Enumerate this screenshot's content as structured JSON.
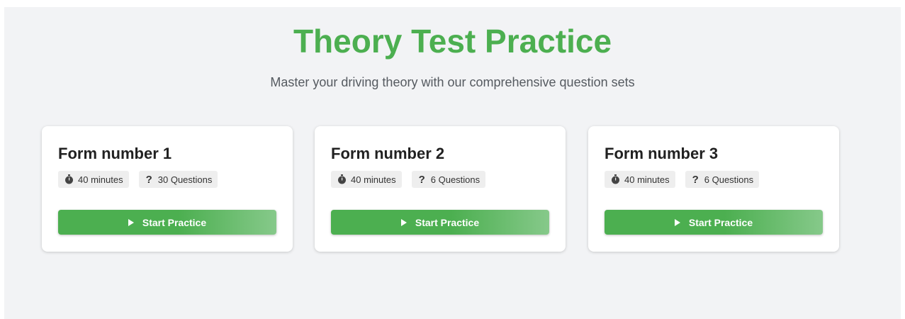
{
  "header": {
    "title": "Theory Test Practice",
    "subtitle": "Master your driving theory with our comprehensive question sets"
  },
  "colors": {
    "accent": "#4caf50",
    "background": "#f2f3f5",
    "card": "#ffffff"
  },
  "forms": [
    {
      "title": "Form number 1",
      "duration": "40 minutes",
      "questions": "30 Questions",
      "duration_icon": "stopwatch-icon",
      "questions_icon": "question-mark-icon",
      "button_label": "Start Practice",
      "button_icon": "play-icon"
    },
    {
      "title": "Form number 2",
      "duration": "40 minutes",
      "questions": "6 Questions",
      "duration_icon": "stopwatch-icon",
      "questions_icon": "question-mark-icon",
      "button_label": "Start Practice",
      "button_icon": "play-icon"
    },
    {
      "title": "Form number 3",
      "duration": "40 minutes",
      "questions": "6 Questions",
      "duration_icon": "stopwatch-icon",
      "questions_icon": "question-mark-icon",
      "button_label": "Start Practice",
      "button_icon": "play-icon"
    }
  ]
}
